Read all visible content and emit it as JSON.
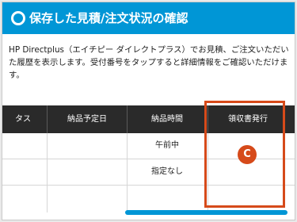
{
  "header": {
    "title": "保存した見積/注文状況の確認",
    "icon": "ring-icon"
  },
  "intro": {
    "text": "HP Directplus（エイチピー ダイレクトプラス）でお見積、ご注文いただいた履歴を表示します。受付番号をタップすると詳細情報をご確認いただけます。"
  },
  "table": {
    "columns": [
      "タス",
      "納品予定日",
      "納品時間",
      "領収書発行"
    ],
    "rows": [
      {
        "delivery_date": "",
        "delivery_time": "午前中",
        "receipt": ""
      },
      {
        "delivery_date": "",
        "delivery_time": "指定なし",
        "receipt": ""
      },
      {
        "delivery_date": "",
        "delivery_time": "",
        "receipt": ""
      }
    ]
  },
  "annotation": {
    "badge": "C",
    "color": "#d64a1a"
  },
  "colors": {
    "header_bg": "#0096d6",
    "table_header_bg": "#2a2a2a",
    "scrollbar": "#0096d6"
  }
}
